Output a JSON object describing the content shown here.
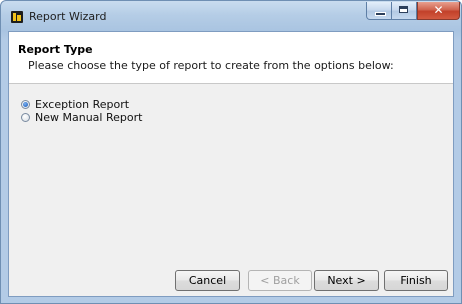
{
  "window": {
    "title": "Report Wizard"
  },
  "header": {
    "title": "Report Type",
    "subtitle": "Please choose the type of report to create from the options below:"
  },
  "options": [
    {
      "label": "Exception Report",
      "selected": true
    },
    {
      "label": "New Manual Report",
      "selected": false
    }
  ],
  "buttons": {
    "cancel": "Cancel",
    "back": "< Back",
    "next": "Next >",
    "finish": "Finish"
  }
}
